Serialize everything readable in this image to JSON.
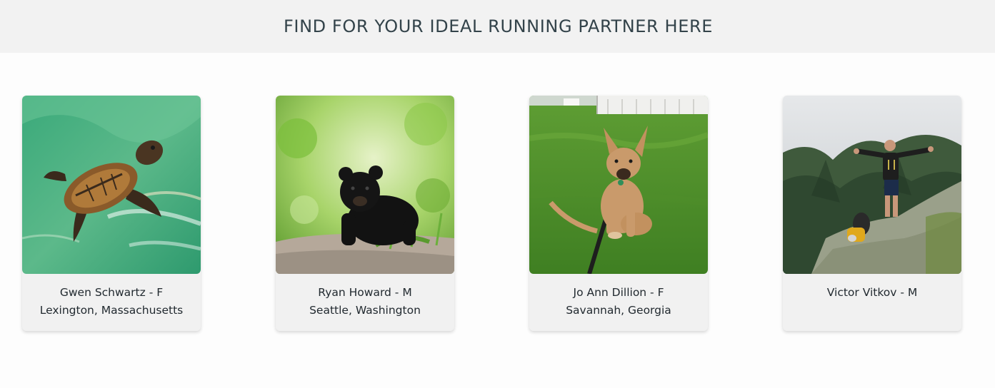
{
  "header": {
    "title": "FIND FOR YOUR IDEAL RUNNING PARTNER HERE"
  },
  "profiles": [
    {
      "name_line": "Gwen Schwartz - F",
      "location": "Lexington, Massachusetts",
      "photo_icon": "sea-turtle-photo"
    },
    {
      "name_line": "Ryan Howard - M",
      "location": "Seattle, Washington",
      "photo_icon": "bear-cub-photo"
    },
    {
      "name_line": "Jo Ann Dillion - F",
      "location": "Savannah, Georgia",
      "photo_icon": "puppy-photo"
    },
    {
      "name_line": "Victor Vitkov - M",
      "location": "",
      "photo_icon": "hiker-photo"
    }
  ]
}
